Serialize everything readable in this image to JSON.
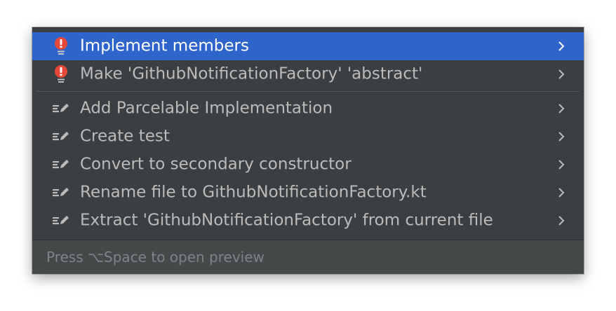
{
  "popup": {
    "items": [
      {
        "label": "Implement members",
        "icon": "error-bulb-icon",
        "selected": true
      },
      {
        "label": "Make 'GithubNotificationFactory' 'abstract'",
        "icon": "error-bulb-icon",
        "selected": false
      },
      {
        "label": "Add Parcelable Implementation",
        "icon": "intention-edit-icon",
        "selected": false
      },
      {
        "label": "Create test",
        "icon": "intention-edit-icon",
        "selected": false
      },
      {
        "label": "Convert to secondary constructor",
        "icon": "intention-edit-icon",
        "selected": false
      },
      {
        "label": "Rename file to GithubNotificationFactory.kt",
        "icon": "intention-edit-icon",
        "selected": false
      },
      {
        "label": "Extract 'GithubNotificationFactory' from current file",
        "icon": "intention-edit-icon",
        "selected": false
      }
    ],
    "footer_hint": "Press ⌥Space to open preview"
  },
  "colors": {
    "popup_background": "#3c3f41",
    "selection": "#2f65ca",
    "error_red": "#e5493a",
    "text": "#bbbbbb",
    "footer_background": "#45494a",
    "footer_text": "#7f8386"
  }
}
